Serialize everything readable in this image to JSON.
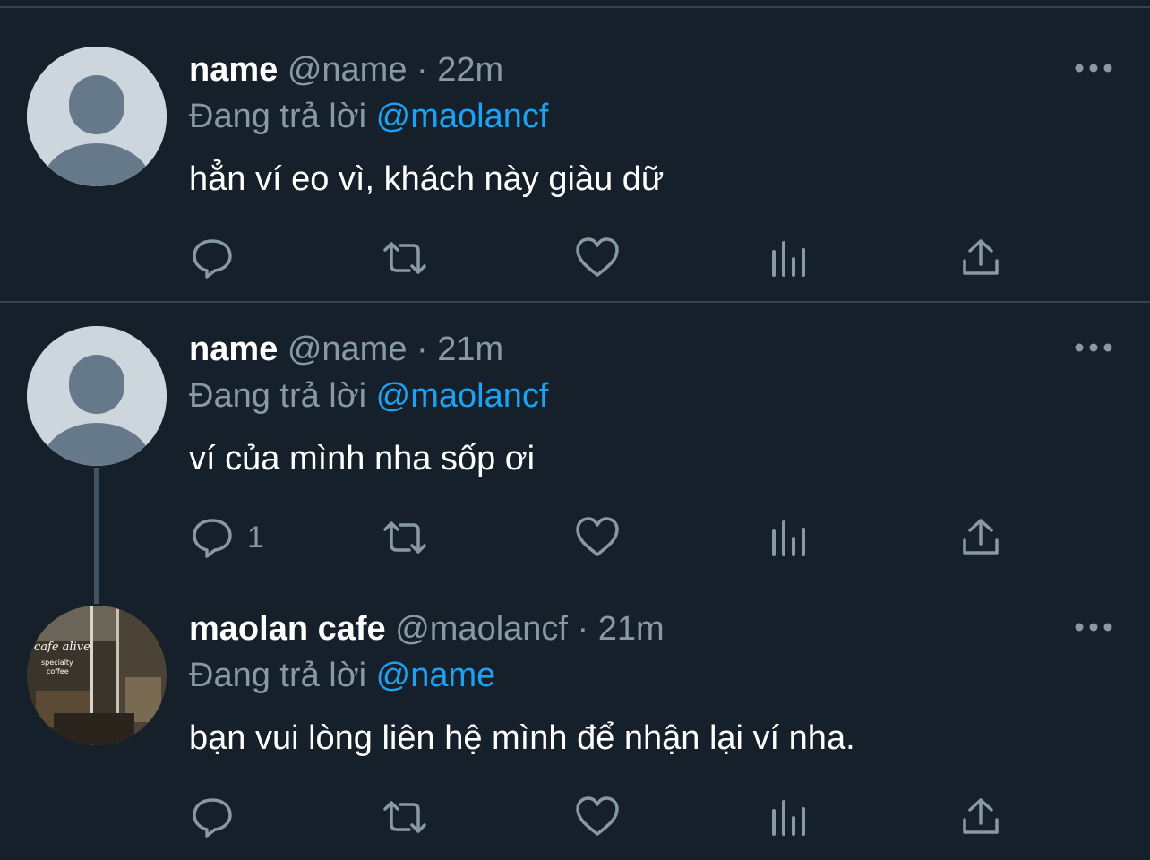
{
  "tweets": [
    {
      "display_name": "name",
      "handle": "@name",
      "separator": "·",
      "time": "22m",
      "reply_prefix": "Đang trả lời",
      "reply_to": "@maolancf",
      "text": "hẳn ví eo vì, khách này giàu dữ",
      "reply_count": "",
      "avatar": "default-avatar"
    },
    {
      "display_name": "name",
      "handle": "@name",
      "separator": "·",
      "time": "21m",
      "reply_prefix": "Đang trả lời",
      "reply_to": "@maolancf",
      "text": "ví của mình nha sốp ơi",
      "reply_count": "1",
      "avatar": "default-avatar"
    },
    {
      "display_name": "maolan cafe",
      "handle": "@maolancf",
      "separator": "·",
      "time": "21m",
      "reply_prefix": "Đang trả lời",
      "reply_to": "@name",
      "text": "bạn vui lòng liên hệ mình để nhận lại ví nha.",
      "reply_count": "",
      "avatar": "cafe-photo-avatar",
      "avatar_text": [
        "cafe alive",
        "specialty",
        "coffee"
      ]
    }
  ],
  "icons": [
    "more-icon",
    "reply-icon",
    "retweet-icon",
    "like-icon",
    "stats-icon",
    "share-icon"
  ],
  "colors": {
    "background": "#15202b",
    "divider": "#38444d",
    "secondary_text": "#8899a6",
    "link": "#1da1f2",
    "primary_text": "#ffffff"
  }
}
